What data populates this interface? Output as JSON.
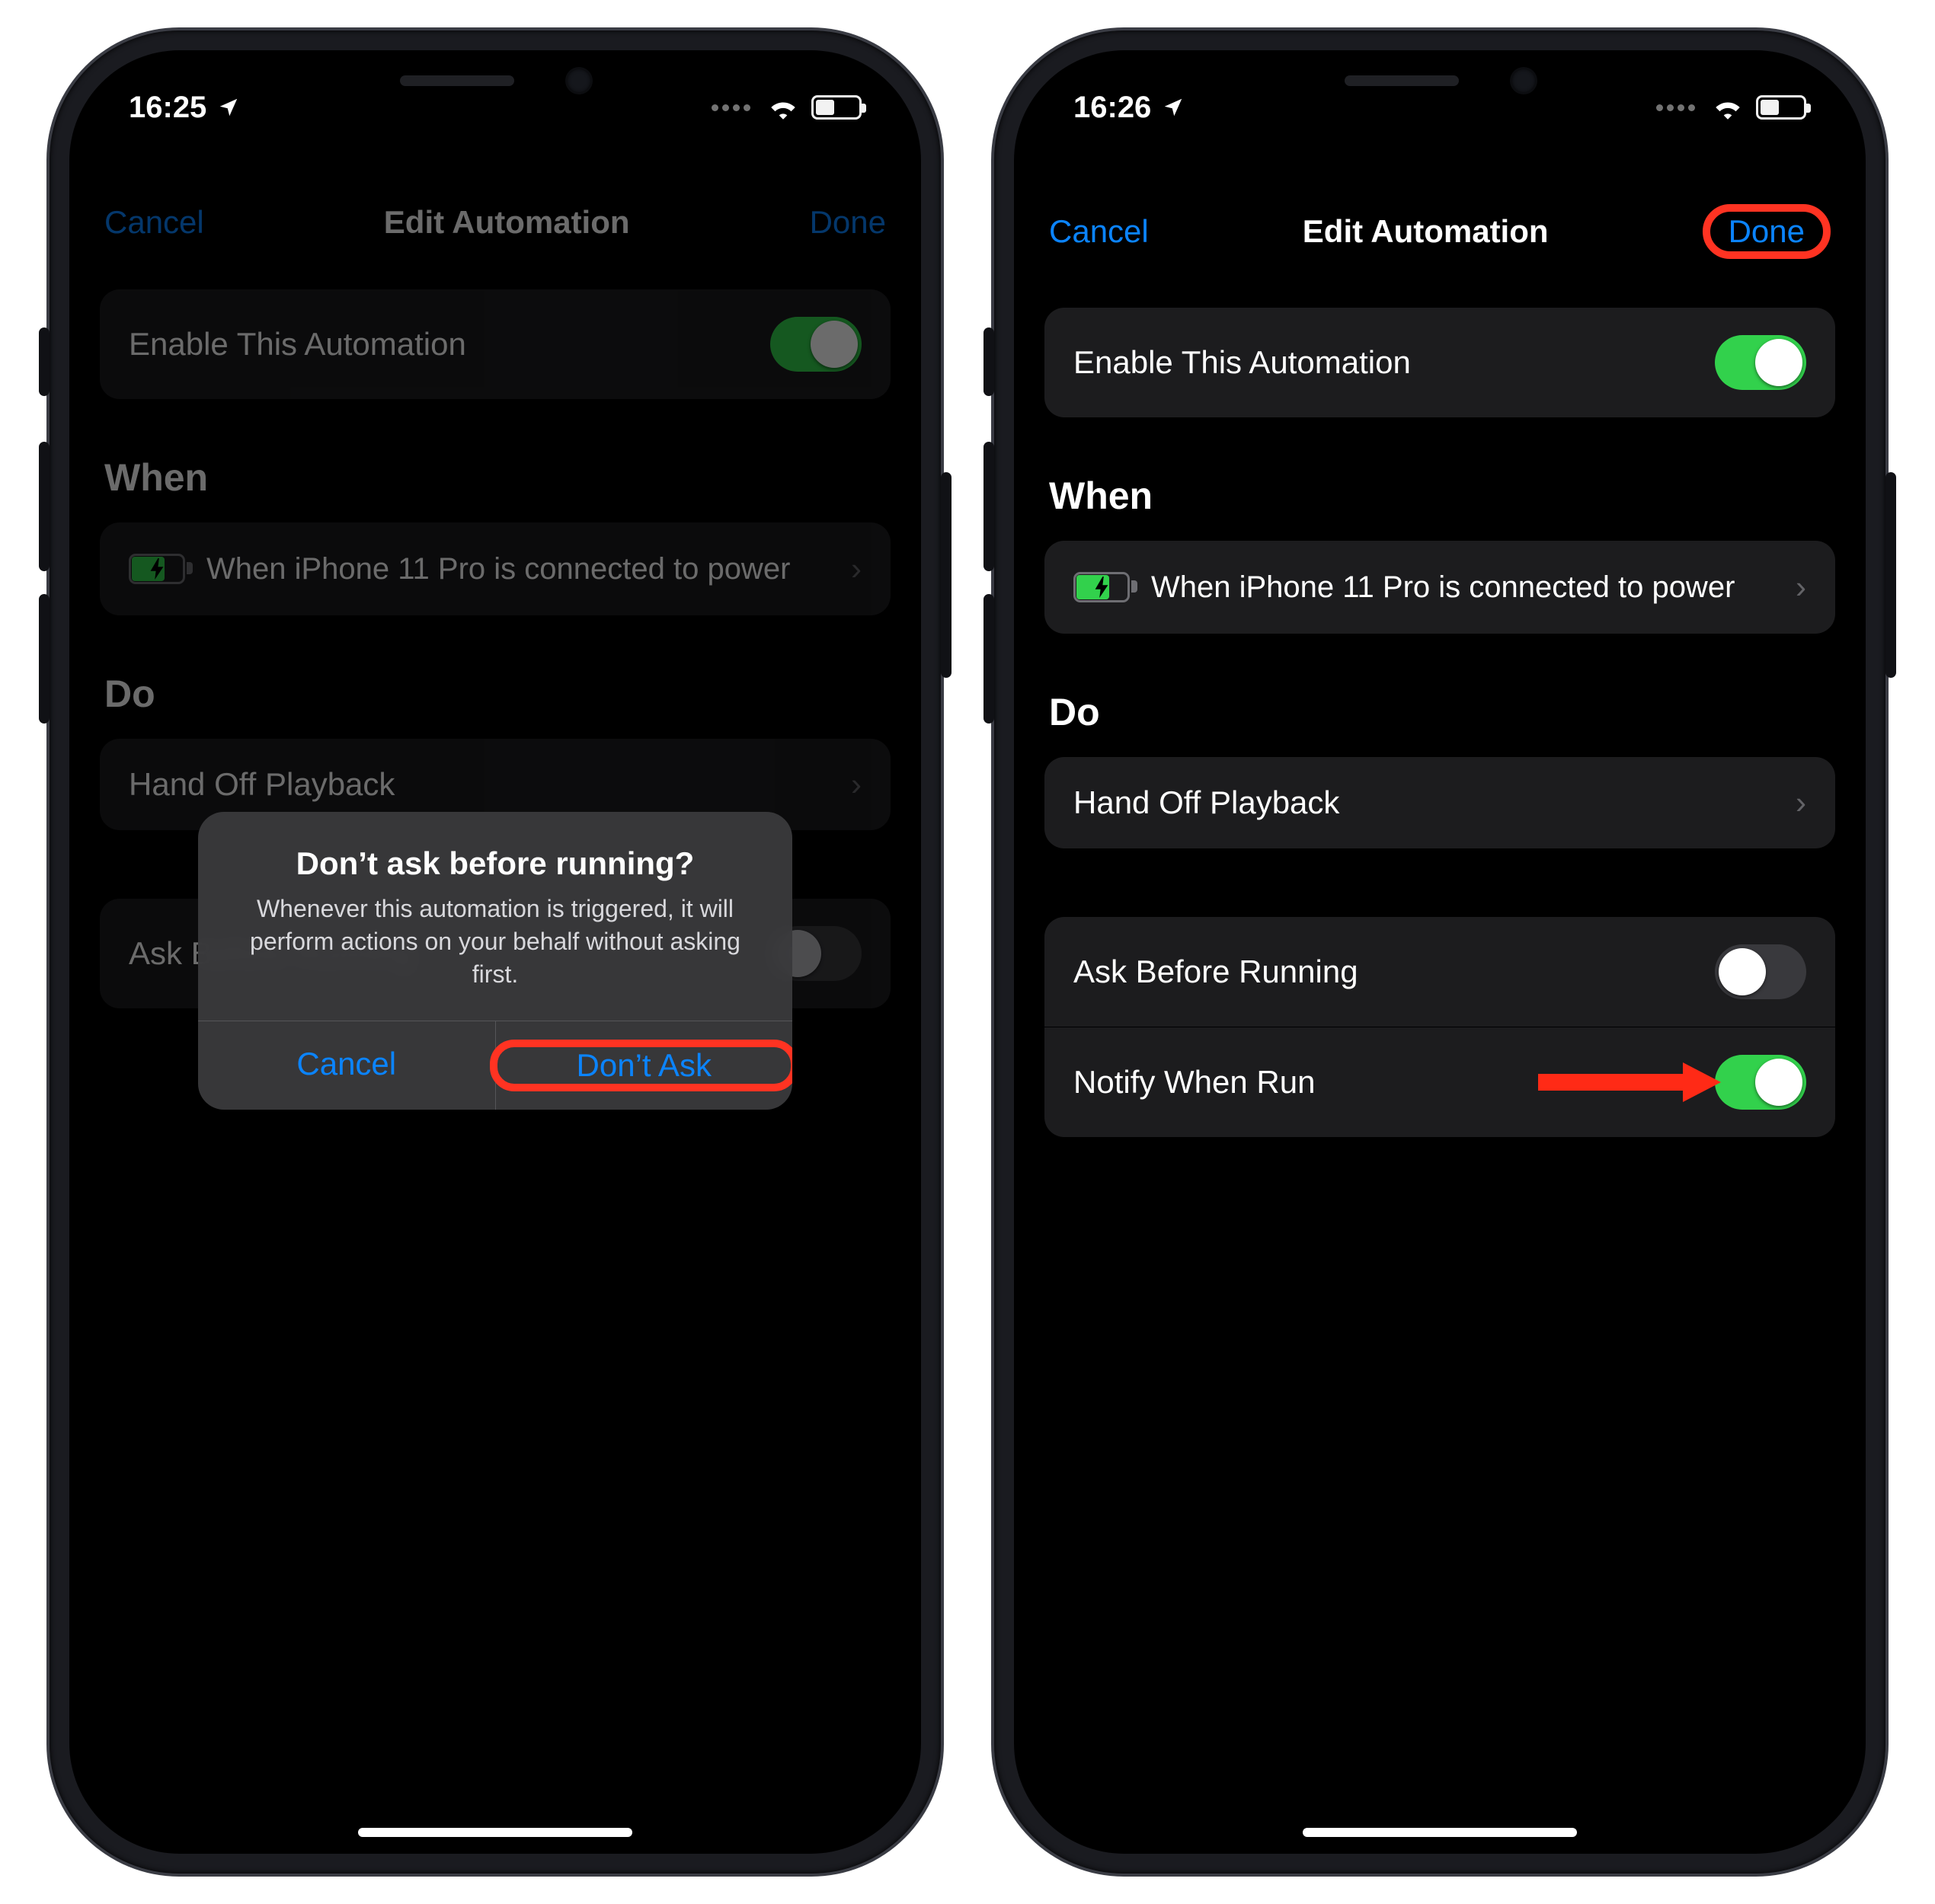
{
  "left": {
    "status": {
      "time": "16:25"
    },
    "nav": {
      "cancel": "Cancel",
      "title": "Edit Automation",
      "done": "Done"
    },
    "enable": {
      "label": "Enable This Automation",
      "on": true
    },
    "when": {
      "header": "When",
      "text": "When iPhone 11 Pro is connected to power"
    },
    "do": {
      "header": "Do",
      "item": "Hand Off Playback"
    },
    "ask": {
      "label": "Ask Before Running",
      "on": false
    },
    "modal": {
      "title": "Don’t ask before running?",
      "text": "Whenever this automation is triggered, it will perform actions on your behalf without asking first.",
      "cancel": "Cancel",
      "confirm": "Don’t Ask"
    }
  },
  "right": {
    "status": {
      "time": "16:26"
    },
    "nav": {
      "cancel": "Cancel",
      "title": "Edit Automation",
      "done": "Done"
    },
    "enable": {
      "label": "Enable This Automation",
      "on": true
    },
    "when": {
      "header": "When",
      "text": "When iPhone 11 Pro is connected to power"
    },
    "do": {
      "header": "Do",
      "item": "Hand Off Playback"
    },
    "ask": {
      "label": "Ask Before Running",
      "on": false
    },
    "notify": {
      "label": "Notify When Run",
      "on": true
    }
  }
}
